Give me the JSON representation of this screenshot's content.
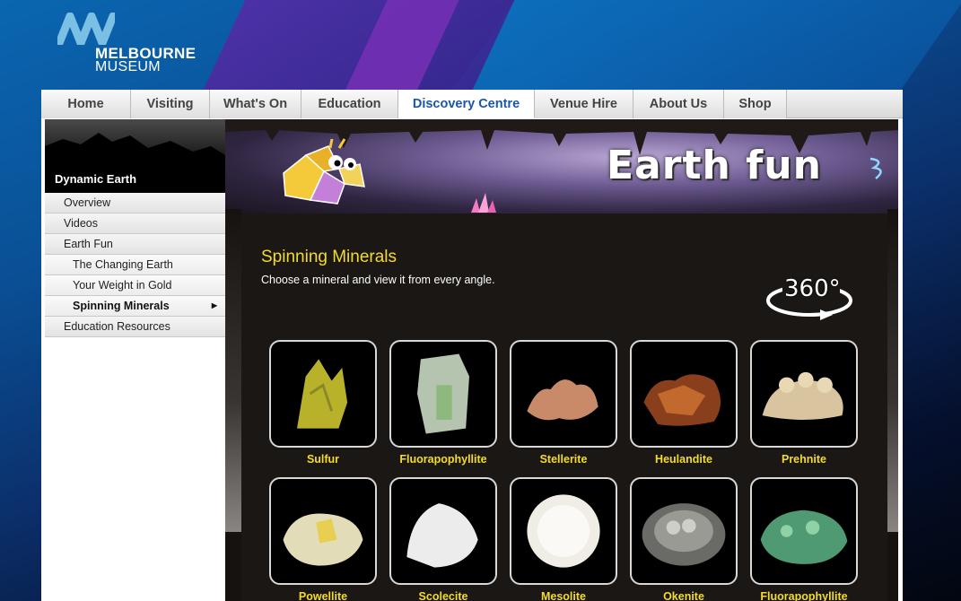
{
  "brand": {
    "name_line1": "MELBOURNE",
    "name_line2": "MUSEUM"
  },
  "nav": [
    {
      "label": "Home",
      "active": false
    },
    {
      "label": "Visiting",
      "active": false
    },
    {
      "label": "What's On",
      "active": false
    },
    {
      "label": "Education",
      "active": false
    },
    {
      "label": "Discovery Centre",
      "active": true
    },
    {
      "label": "Venue Hire",
      "active": false
    },
    {
      "label": "About Us",
      "active": false
    },
    {
      "label": "Shop",
      "active": false
    }
  ],
  "sidebar": {
    "title": "Dynamic Earth",
    "items": [
      {
        "label": "Overview"
      },
      {
        "label": "Videos"
      },
      {
        "label": "Earth Fun"
      },
      {
        "label": "The Changing Earth"
      },
      {
        "label": "Your Weight in Gold"
      },
      {
        "label": "Spinning Minerals"
      },
      {
        "label": "Education Resources"
      }
    ]
  },
  "banner": {
    "title": "Earth fun"
  },
  "section": {
    "title": "Spinning Minerals",
    "description": "Choose a mineral and view it from every angle.",
    "badge": "360°"
  },
  "minerals": [
    {
      "label": "Sulfur",
      "color": "#b8b22a"
    },
    {
      "label": "Fluorapophyllite",
      "color": "#c9d9c2"
    },
    {
      "label": "Stellerite",
      "color": "#c98a6a"
    },
    {
      "label": "Heulandite",
      "color": "#c26a2e"
    },
    {
      "label": "Prehnite",
      "color": "#d8c49e"
    },
    {
      "label": "Powellite",
      "color": "#e3dcb8"
    },
    {
      "label": "Scolecite",
      "color": "#ececec"
    },
    {
      "label": "Mesolite",
      "color": "#f0ede6"
    },
    {
      "label": "Okenite",
      "color": "#9a9a95"
    },
    {
      "label": "Fluorapophyllite",
      "color": "#4f9a72"
    }
  ],
  "colors": {
    "accent": "#1b57a6",
    "highlight": "#f3dc2b"
  }
}
